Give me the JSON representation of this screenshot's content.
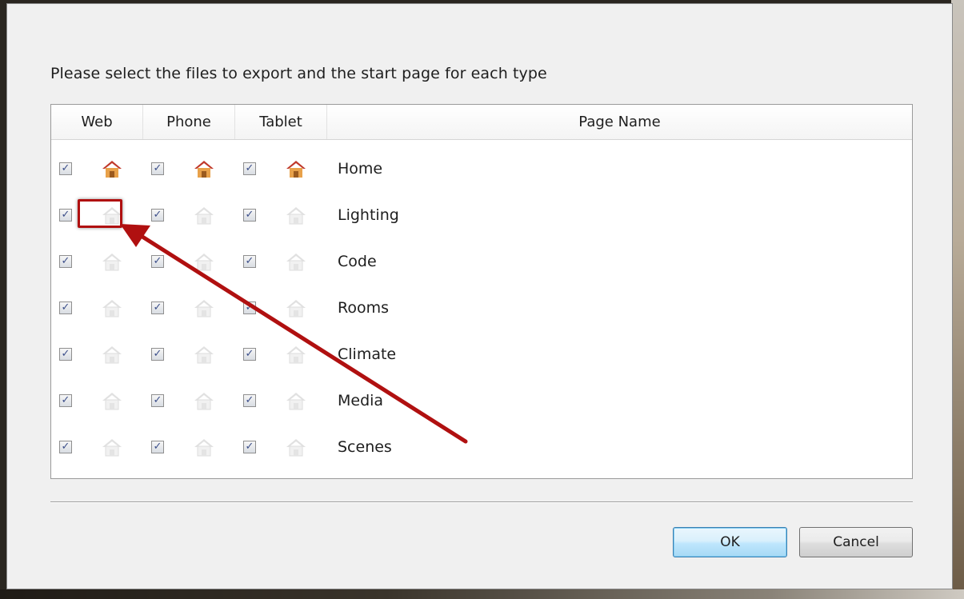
{
  "dialog": {
    "prompt": "Please select the files to export and the start page for each type",
    "columns": {
      "web": "Web",
      "phone": "Phone",
      "tablet": "Tablet",
      "page_name": "Page Name"
    },
    "rows": [
      {
        "name": "Home",
        "web_checked": true,
        "phone_checked": true,
        "tablet_checked": true,
        "start_page": true
      },
      {
        "name": "Lighting",
        "web_checked": true,
        "phone_checked": true,
        "tablet_checked": true,
        "start_page": false
      },
      {
        "name": "Code",
        "web_checked": true,
        "phone_checked": true,
        "tablet_checked": true,
        "start_page": false
      },
      {
        "name": "Rooms",
        "web_checked": true,
        "phone_checked": true,
        "tablet_checked": true,
        "start_page": false
      },
      {
        "name": "Climate",
        "web_checked": true,
        "phone_checked": true,
        "tablet_checked": true,
        "start_page": false
      },
      {
        "name": "Media",
        "web_checked": true,
        "phone_checked": true,
        "tablet_checked": true,
        "start_page": false
      },
      {
        "name": "Scenes",
        "web_checked": true,
        "phone_checked": true,
        "tablet_checked": true,
        "start_page": false
      }
    ],
    "buttons": {
      "ok": "OK",
      "cancel": "Cancel"
    }
  },
  "annotation": {
    "color": "#b01010"
  },
  "icons": {
    "checkbox": "checkmark",
    "start_page_active": "house-icon-active",
    "start_page_inactive": "house-icon-inactive"
  }
}
